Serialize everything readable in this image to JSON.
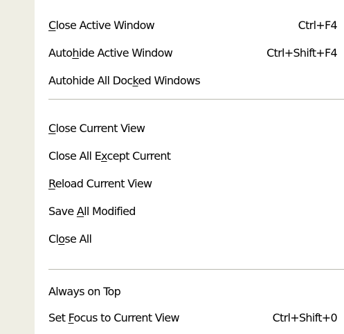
{
  "menu": {
    "items": [
      {
        "pre": "",
        "acc": "C",
        "post": "lose Active Window",
        "shortcut": "Ctrl+F4"
      },
      {
        "pre": "Auto",
        "acc": "h",
        "post": "ide Active Window",
        "shortcut": "Ctrl+Shift+F4"
      },
      {
        "pre": "Autohide All Doc",
        "acc": "k",
        "post": "ed Windows",
        "shortcut": ""
      },
      {
        "pre": "",
        "acc": "C",
        "post": "lose Current View",
        "shortcut": ""
      },
      {
        "pre": "Close All E",
        "acc": "x",
        "post": "cept Current",
        "shortcut": ""
      },
      {
        "pre": "",
        "acc": "R",
        "post": "eload Current View",
        "shortcut": ""
      },
      {
        "pre": "Save ",
        "acc": "A",
        "post": "ll Modified",
        "shortcut": ""
      },
      {
        "pre": "Cl",
        "acc": "o",
        "post": "se All",
        "shortcut": ""
      },
      {
        "pre": "Always on Top",
        "acc": "",
        "post": "",
        "shortcut": ""
      },
      {
        "pre": "Set ",
        "acc": "F",
        "post": "ocus to Current View",
        "shortcut": "Ctrl+Shift+0"
      }
    ]
  }
}
